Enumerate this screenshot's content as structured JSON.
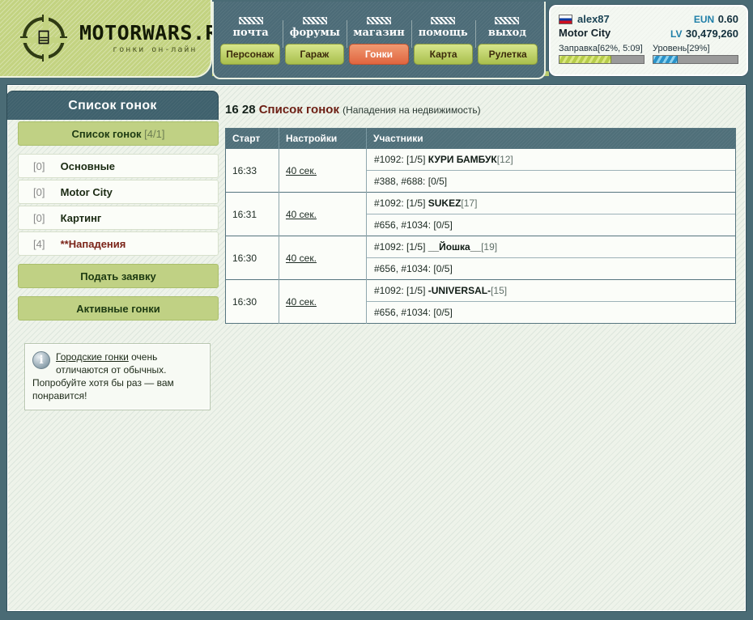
{
  "brand": {
    "title": "MOTORWARS.RU",
    "subtitle": "гонки он-лайн",
    "logo_icon": "crosshair-logo-icon",
    "glyph": "⌸"
  },
  "nav": {
    "top_links": [
      {
        "label": "почта",
        "icon": "checkered-flag-icon"
      },
      {
        "label": "форумы",
        "icon": "checkered-flag-icon"
      },
      {
        "label": "магазин",
        "icon": "checkered-flag-icon"
      },
      {
        "label": "помощь",
        "icon": "checkered-flag-icon"
      },
      {
        "label": "выход",
        "icon": "checkered-flag-icon"
      }
    ],
    "tabs": [
      {
        "label": "Персонаж",
        "active": false
      },
      {
        "label": "Гараж",
        "active": false
      },
      {
        "label": "Гонки",
        "active": true
      },
      {
        "label": "Карта",
        "active": false
      },
      {
        "label": "Рулетка",
        "active": false
      }
    ],
    "active_color": "#e0653f",
    "tab_color": "#c0d184"
  },
  "user": {
    "flag": "ru-flag-icon",
    "name": "alex87",
    "city": "Motor City",
    "currency_eun_label": "EUN",
    "currency_eun_value": "0.60",
    "currency_lv_label": "LV",
    "currency_lv_value": "30,479,260",
    "fuel_label": "Заправка[62%, 5:09]",
    "fuel_percent": 62,
    "level_label": "Уровень[29%]",
    "level_percent": 29
  },
  "sidebar": {
    "header": "Список гонок",
    "list_button": {
      "label": "Список гонок",
      "count": "[4/1]"
    },
    "items": [
      {
        "count": "[0]",
        "label": "Основные",
        "attack": false
      },
      {
        "count": "[0]",
        "label": "Motor City",
        "attack": false
      },
      {
        "count": "[0]",
        "label": "Картинг",
        "attack": false
      },
      {
        "count": "[4]",
        "label": "**Нападения",
        "attack": true
      }
    ],
    "apply_button": "Подать заявку",
    "active_button": "Активные гонки",
    "info": {
      "icon": "info-icon",
      "link": "Городские гонки",
      "text_rest": " очень отличаются от обычных. Попробуйте хотя бы раз — вам понравится!"
    }
  },
  "main": {
    "title_numbers": "16 28",
    "title": "Список гонок",
    "title_sub": "(Нападения на недвижимость)",
    "table": {
      "columns": [
        "Старт",
        "Настройки",
        "Участники"
      ],
      "rows": [
        {
          "start": "16:33",
          "settings": "40 сек.",
          "participants": [
            {
              "id": "#1092:",
              "slot": "[1/5]",
              "name": "КУРИ БАМБУК",
              "level": "[12]"
            },
            {
              "id": "#388, #688:",
              "slot": "[0/5]",
              "name": "",
              "level": ""
            }
          ]
        },
        {
          "start": "16:31",
          "settings": "40 сек.",
          "participants": [
            {
              "id": "#1092:",
              "slot": "[1/5]",
              "name": "SUKEZ",
              "level": "[17]"
            },
            {
              "id": "#656, #1034:",
              "slot": "[0/5]",
              "name": "",
              "level": ""
            }
          ]
        },
        {
          "start": "16:30",
          "settings": "40 сек.",
          "participants": [
            {
              "id": "#1092:",
              "slot": "[1/5]",
              "name": "__Йошка__",
              "level": "[19]"
            },
            {
              "id": "#656, #1034:",
              "slot": "[0/5]",
              "name": "",
              "level": ""
            }
          ]
        },
        {
          "start": "16:30",
          "settings": "40 сек.",
          "participants": [
            {
              "id": "#1092:",
              "slot": "[1/5]",
              "name": "-UNIVERSAL-",
              "level": "[15]"
            },
            {
              "id": "#656, #1034:",
              "slot": "[0/5]",
              "name": "",
              "level": ""
            }
          ]
        }
      ]
    }
  }
}
